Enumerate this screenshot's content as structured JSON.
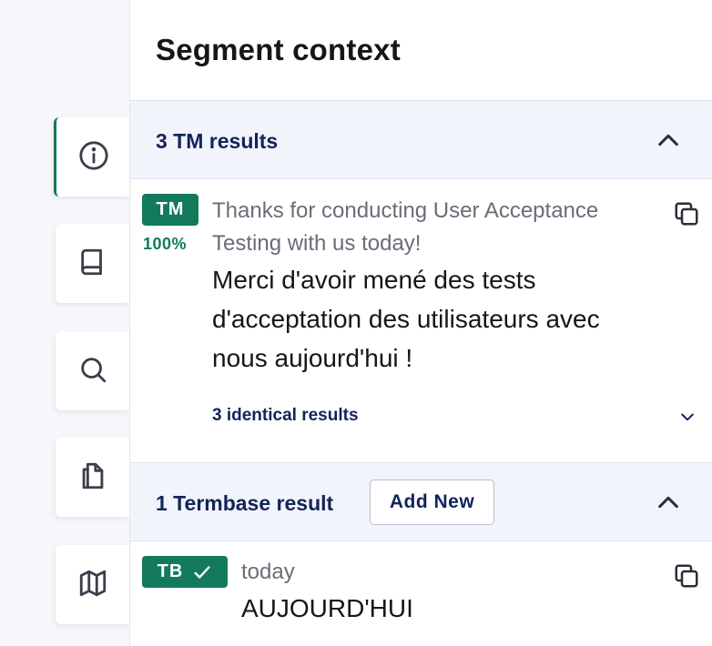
{
  "sidebar": {
    "items": [
      {
        "name": "info",
        "icon": "info-icon",
        "active": true
      },
      {
        "name": "book",
        "icon": "book-icon",
        "active": false
      },
      {
        "name": "search",
        "icon": "search-icon",
        "active": false
      },
      {
        "name": "documents",
        "icon": "documents-icon",
        "active": false
      },
      {
        "name": "map",
        "icon": "map-icon",
        "active": false
      }
    ]
  },
  "panel": {
    "title": "Segment context"
  },
  "tm_section": {
    "title": "3 TM results",
    "result": {
      "badge": "TM",
      "match": "100%",
      "source_line1": "Thanks for conducting User Acceptance",
      "source_line2": "Testing with us today!",
      "target_line1": "Merci d'avoir mené des tests",
      "target_line2": "d'acceptation des utilisateurs avec",
      "target_line3": "nous aujourd'hui !",
      "identical_link": "3 identical results"
    }
  },
  "tb_section": {
    "title": "1 Termbase result",
    "add_label": "Add New",
    "result": {
      "badge": "TB",
      "source": "today",
      "target": "AUJOURD'HUI"
    }
  },
  "colors": {
    "accent": "#127a5b",
    "navy": "#13245a",
    "section_bg": "#f2f4fb"
  }
}
